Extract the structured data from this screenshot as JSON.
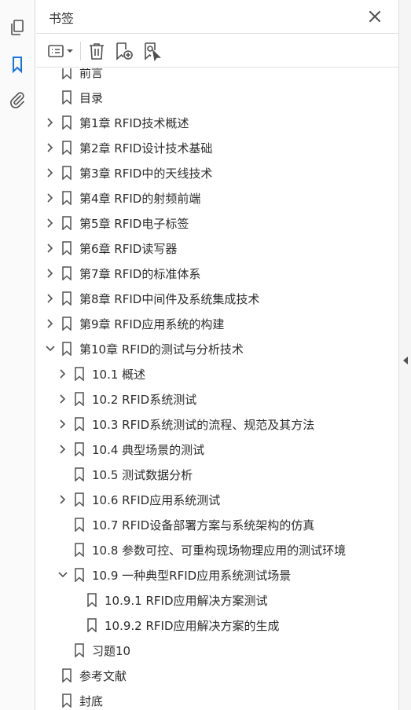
{
  "panel": {
    "title": "书签"
  },
  "toolbar": {
    "options_icon": "list-options-icon",
    "delete_icon": "trash-icon",
    "new_bookmark_icon": "add-bookmark-icon",
    "bookmark_from_selection_icon": "bookmark-selection-icon"
  },
  "left_rail": {
    "items": [
      "pages-icon",
      "bookmark-icon",
      "paperclip-icon"
    ],
    "active": "bookmark-icon"
  },
  "bookmarks": [
    {
      "label": "前言",
      "level": 0,
      "expander": "none"
    },
    {
      "label": "目录",
      "level": 0,
      "expander": "none"
    },
    {
      "label": "第1章  RFID技术概述",
      "level": 0,
      "expander": "collapsed"
    },
    {
      "label": "第2章  RFID设计技术基础",
      "level": 0,
      "expander": "collapsed"
    },
    {
      "label": "第3章  RFID中的天线技术",
      "level": 0,
      "expander": "collapsed"
    },
    {
      "label": "第4章  RFID的射频前端",
      "level": 0,
      "expander": "collapsed"
    },
    {
      "label": "第5章  RFID电子标签",
      "level": 0,
      "expander": "collapsed"
    },
    {
      "label": "第6章  RFID读写器",
      "level": 0,
      "expander": "collapsed"
    },
    {
      "label": "第7章  RFID的标准体系",
      "level": 0,
      "expander": "collapsed"
    },
    {
      "label": "第8章  RFID中间件及系统集成技术",
      "level": 0,
      "expander": "collapsed"
    },
    {
      "label": "第9章  RFID应用系统的构建",
      "level": 0,
      "expander": "collapsed"
    },
    {
      "label": "第10章  RFID的测试与分析技术",
      "level": 0,
      "expander": "expanded"
    },
    {
      "label": "10.1  概述",
      "level": 1,
      "expander": "collapsed"
    },
    {
      "label": "10.2  RFID系统测试",
      "level": 1,
      "expander": "collapsed"
    },
    {
      "label": "10.3  RFID系统测试的流程、规范及其方法",
      "level": 1,
      "expander": "collapsed"
    },
    {
      "label": "10.4  典型场景的测试",
      "level": 1,
      "expander": "collapsed"
    },
    {
      "label": "10.5  测试数据分析",
      "level": 1,
      "expander": "none"
    },
    {
      "label": "10.6  RFID应用系统测试",
      "level": 1,
      "expander": "collapsed"
    },
    {
      "label": "10.7  RFID设备部署方案与系统架构的仿真",
      "level": 1,
      "expander": "none"
    },
    {
      "label": "10.8  参数可控、可重构现场物理应用的测试环境",
      "level": 1,
      "expander": "none"
    },
    {
      "label": "10.9  一种典型RFID应用系统测试场景",
      "level": 1,
      "expander": "expanded"
    },
    {
      "label": "10.9.1  RFID应用解决方案测试",
      "level": 2,
      "expander": "none"
    },
    {
      "label": "10.9.2  RFID应用解决方案的生成",
      "level": 2,
      "expander": "none"
    },
    {
      "label": "习题10",
      "level": 1,
      "expander": "none"
    },
    {
      "label": "参考文献",
      "level": 0,
      "expander": "none"
    },
    {
      "label": "封底",
      "level": 0,
      "expander": "none"
    }
  ],
  "scroll": {
    "position": 0.13,
    "visible_fraction": 0.85
  },
  "colors": {
    "accent": "#1473e6",
    "text": "#2c2c2c",
    "icon": "#505050"
  }
}
